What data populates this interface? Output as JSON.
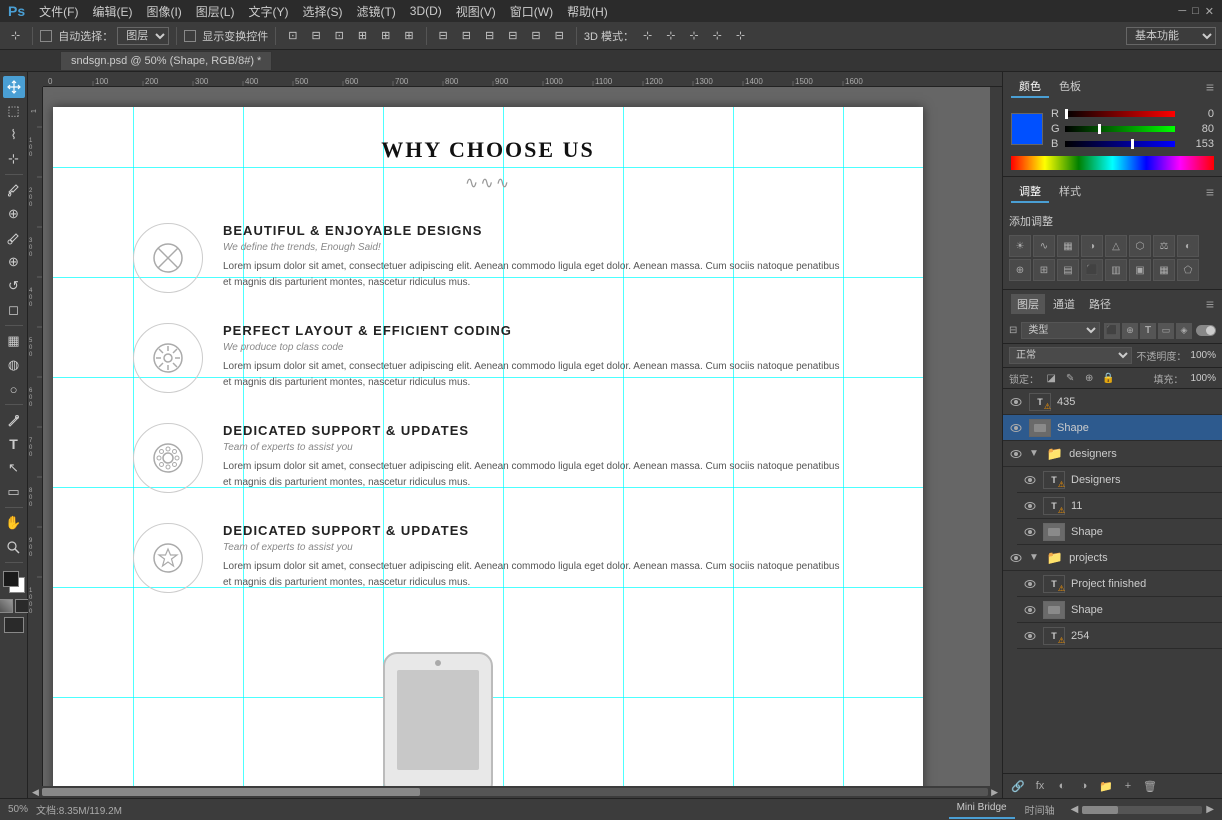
{
  "app": {
    "name": "Adobe Photoshop",
    "logo": "Ps"
  },
  "menubar": {
    "items": [
      "文件(F)",
      "编辑(E)",
      "图像(I)",
      "图层(L)",
      "文字(Y)",
      "选择(S)",
      "滤镜(T)",
      "3D(D)",
      "视图(V)",
      "窗口(W)",
      "帮助(H)"
    ]
  },
  "toolbar": {
    "auto_select_label": "自动选择：",
    "layer_label": "图层",
    "show_transform_label": "显示变换控件",
    "mode_label": "3D 模式：",
    "workspace_label": "基本功能"
  },
  "tab": {
    "title": "sndsgn.psd @ 50% (Shape, RGB/8#) *"
  },
  "canvas": {
    "zoom": "50%",
    "doc_info": "文档:8.35M/119.2M"
  },
  "content": {
    "section_title": "WHY CHOOSE US",
    "section_wavy": "∿∿∿",
    "features": [
      {
        "icon": "✕",
        "title": "BEAUTIFUL & ENJOYABLE DESIGNS",
        "tagline": "We define the trends, Enough Said!",
        "desc": "Lorem ipsum dolor sit amet, consectetuer adipiscing elit. Aenean commodo ligula eget dolor. Aenean massa. Cum sociis natoque penatibus et magnis dis parturient montes, nascetur ridiculus mus."
      },
      {
        "icon": "⚙",
        "title": "PERFECT LAYOUT & EFFICIENT CODING",
        "tagline": "We produce top class code",
        "desc": "Lorem ipsum dolor sit amet, consectetuer adipiscing elit. Aenean commodo ligula eget dolor. Aenean massa. Cum sociis natoque penatibus et magnis dis parturient montes, nascetur ridiculus mus."
      },
      {
        "icon": "❋",
        "title": "DEDICATED SUPPORT & UPDATES",
        "tagline": "Team of experts to assist you",
        "desc": "Lorem ipsum dolor sit amet, consectetuer adipiscing elit. Aenean commodo ligula eget dolor. Aenean massa. Cum sociis natoque penatibus et magnis dis parturient montes, nascetur ridiculus mus."
      },
      {
        "icon": "★",
        "title": "DEDICATED SUPPORT & UPDATES",
        "tagline": "Team of experts to assist you",
        "desc": "Lorem ipsum dolor sit amet, consectetuer adipiscing elit. Aenean commodo ligula eget dolor. Aenean massa. Cum sociis natoque penatibus et magnis dis parturient montes, nascetur ridiculus mus."
      }
    ]
  },
  "color_panel": {
    "tab1": "颜色",
    "tab2": "色板",
    "r_value": "0",
    "g_value": "80",
    "b_value": "153"
  },
  "adjustments_panel": {
    "title": "调整",
    "tab1": "调整",
    "tab2": "样式",
    "add_label": "添加调整"
  },
  "layers_panel": {
    "tabs": [
      "图层",
      "通道",
      "路径"
    ],
    "blend_mode": "正常",
    "opacity_label": "不透明度：",
    "opacity_value": "100%",
    "lock_label": "锁定：",
    "fill_label": "填充：",
    "fill_value": "100%",
    "search_placeholder": "类型",
    "layers": [
      {
        "id": 1,
        "name": "435",
        "type": "text",
        "visible": true,
        "warning": true
      },
      {
        "id": 2,
        "name": "Shape",
        "type": "shape",
        "visible": true,
        "selected": true
      },
      {
        "id": 3,
        "name": "designers",
        "type": "group",
        "visible": true,
        "open": true
      },
      {
        "id": 4,
        "name": "Designers",
        "type": "text",
        "visible": true,
        "warning": true,
        "indent": true
      },
      {
        "id": 5,
        "name": "11",
        "type": "text",
        "visible": true,
        "warning": true,
        "indent": true
      },
      {
        "id": 6,
        "name": "Shape",
        "type": "shape",
        "visible": true,
        "indent": true
      },
      {
        "id": 7,
        "name": "projects",
        "type": "group",
        "visible": true,
        "open": true
      },
      {
        "id": 8,
        "name": "Project finished",
        "type": "text",
        "visible": true,
        "warning": true,
        "indent": true
      },
      {
        "id": 9,
        "name": "Shape",
        "type": "shape",
        "visible": true,
        "indent": true
      },
      {
        "id": 10,
        "name": "254",
        "type": "text",
        "visible": true,
        "warning": true,
        "indent": true
      }
    ]
  },
  "bottom_bar": {
    "zoom": "50%",
    "doc_info": "文档:8.35M/119.2M",
    "tabs": [
      "Mini Bridge",
      "时间轴"
    ]
  }
}
